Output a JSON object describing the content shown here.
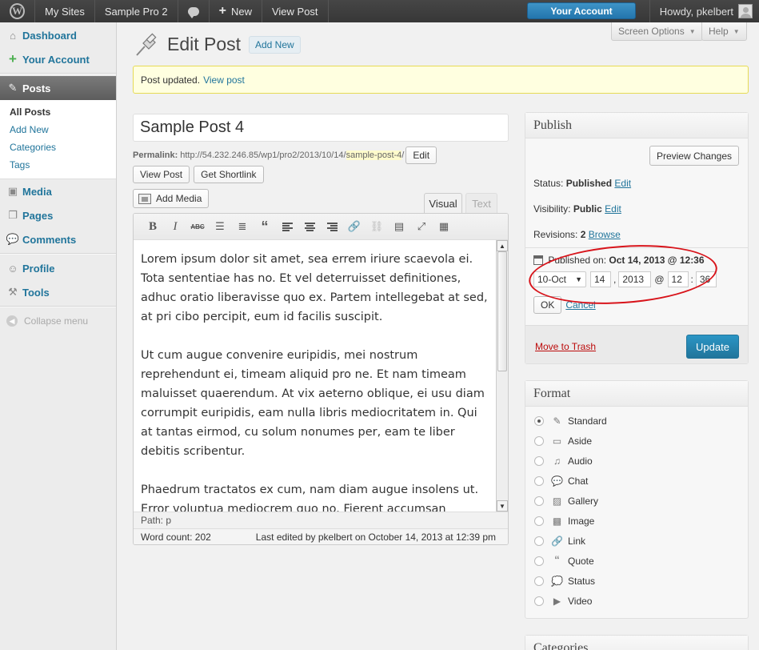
{
  "adminbar": {
    "my_sites": "My Sites",
    "site_name": "Sample Pro 2",
    "new_label": "New",
    "view_post": "View Post",
    "your_account": "Your Account",
    "howdy": "Howdy, pkelbert"
  },
  "sidebar": {
    "dashboard": "Dashboard",
    "your_account": "Your Account",
    "posts": "Posts",
    "submenu": [
      "All Posts",
      "Add New",
      "Categories",
      "Tags"
    ],
    "media": "Media",
    "pages": "Pages",
    "comments": "Comments",
    "profile": "Profile",
    "tools": "Tools",
    "collapse": "Collapse menu"
  },
  "header": {
    "screen_options": "Screen Options",
    "help": "Help",
    "title": "Edit Post",
    "add_new": "Add New"
  },
  "notice": {
    "text": "Post updated.",
    "link": "View post"
  },
  "post": {
    "title": "Sample Post 4",
    "permalink_label": "Permalink:",
    "permalink_base": "http://54.232.246.85/wp1/pro2/2013/10/14/",
    "slug": "sample-post-4",
    "permalink_end": "/",
    "edit_btn": "Edit",
    "view_post_btn": "View Post",
    "shortlink_btn": "Get Shortlink",
    "add_media": "Add Media",
    "tab_visual": "Visual",
    "tab_text": "Text"
  },
  "editor": {
    "paragraphs": [
      "Lorem ipsum dolor sit amet, sea errem iriure scaevola ei. Tota sententiae has no. Et vel deterruisset definitiones, adhuc oratio liberavisse quo ex. Partem intellegebat at sed, at pri cibo percipit, eum id facilis suscipit.",
      "Ut cum augue convenire euripidis, mei nostrum reprehendunt ei, timeam aliquid pro ne. Et nam timeam maluisset quaerendum. At vix aeterno oblique, ei usu diam corrumpit euripidis, eam nulla libris mediocritatem in. Qui at tantas eirmod, cu solum nonumes per, eam te liber debitis scribentur.",
      "Phaedrum tractatos ex cum, nam diam augue insolens ut. Error voluptua mediocrem quo no. Fierent accumsan argumentum mea ea, eum et euripidis abhorreant dissentias. Vis ullamcorper"
    ],
    "path": "Path: p",
    "word_count": "Word count: 202",
    "last_edited": "Last edited by pkelbert on October 14, 2013 at 12:39 pm"
  },
  "publish": {
    "title": "Publish",
    "preview": "Preview Changes",
    "status_label": "Status:",
    "status_value": "Published",
    "visibility_label": "Visibility:",
    "visibility_value": "Public",
    "revisions_label": "Revisions:",
    "revisions_value": "2",
    "browse": "Browse",
    "edit": "Edit",
    "published_on_label": "Published on:",
    "published_on_value": "Oct 14, 2013 @ 12:36",
    "month": "10-Oct",
    "day": "14",
    "year": "2013",
    "hour": "12",
    "minute": "36",
    "at": "@",
    "comma": ",",
    "colon": ":",
    "ok": "OK",
    "cancel": "Cancel",
    "trash": "Move to Trash",
    "update": "Update"
  },
  "format": {
    "title": "Format",
    "options": [
      "Standard",
      "Aside",
      "Audio",
      "Chat",
      "Gallery",
      "Image",
      "Link",
      "Quote",
      "Status",
      "Video"
    ],
    "selected": "Standard"
  },
  "categories": {
    "title": "Categories"
  }
}
